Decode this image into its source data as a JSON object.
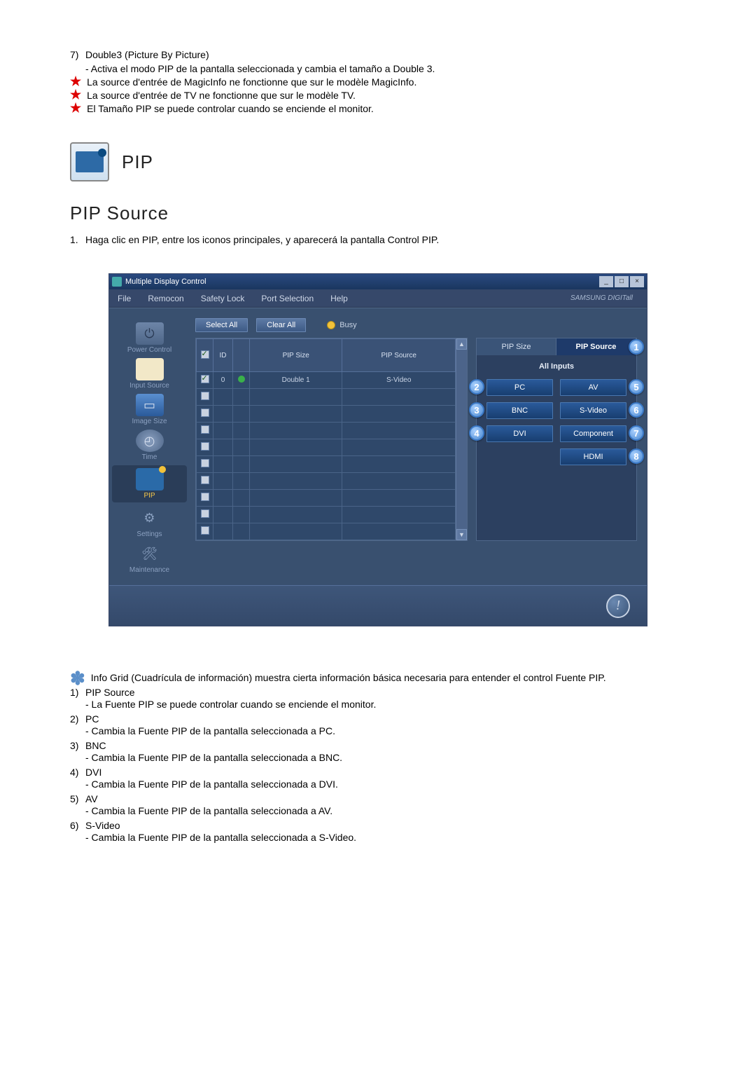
{
  "intro": {
    "item7_num": "7)",
    "item7_title": "Double3 (Picture By Picture)",
    "item7_desc": "- Activa el modo PIP de la pantalla seleccionada y cambia el tamaño a Double 3.",
    "star1": "La source d'entrée de MagicInfo ne fonctionne que sur le modèle MagicInfo.",
    "star2": "La source d'entrée de TV ne fonctionne que sur le modèle TV.",
    "star3": "El Tamaño PIP se puede controlar cuando se enciende el monitor."
  },
  "pip_label": "PIP",
  "section_title": "PIP Source",
  "section_line1_num": "1.",
  "section_line1_text": "Haga clic en PIP, entre los iconos principales, y aparecerá la pantalla Control PIP.",
  "window": {
    "title": "Multiple Display Control",
    "menu": {
      "file": "File",
      "remocon": "Remocon",
      "safety": "Safety Lock",
      "port": "Port Selection",
      "help": "Help"
    },
    "brand": "SAMSUNG DIGITall",
    "sidebar": {
      "power": "Power Control",
      "input": "Input Source",
      "image": "Image Size",
      "time": "Time",
      "pip": "PIP",
      "settings": "Settings",
      "maintenance": "Maintenance"
    },
    "buttons": {
      "select_all": "Select All",
      "clear_all": "Clear All",
      "busy": "Busy"
    },
    "headers": {
      "id": "ID",
      "pipsize": "PIP Size",
      "pipsource": "PIP Source"
    },
    "row0": {
      "id": "0",
      "size": "Double 1",
      "source": "S-Video"
    },
    "right": {
      "tab1": "PIP Size",
      "tab2": "PIP Source",
      "all_inputs": "All Inputs",
      "pc": "PC",
      "av": "AV",
      "bnc": "BNC",
      "svideo": "S-Video",
      "dvi": "DVI",
      "component": "Component",
      "hdmi": "HDMI"
    },
    "callouts": {
      "c1": "1",
      "c2": "2",
      "c3": "3",
      "c4": "4",
      "c5": "5",
      "c6": "6",
      "c7": "7",
      "c8": "8"
    }
  },
  "post_star": "Info Grid (Cuadrícula de información) muestra cierta información básica necesaria para entender el control Fuente PIP.",
  "list": {
    "n1": "1)",
    "t1": "PIP Source",
    "d1": "- La Fuente PIP se puede controlar cuando se enciende el monitor.",
    "n2": "2)",
    "t2": "PC",
    "d2": "- Cambia la Fuente PIP de la pantalla seleccionada a PC.",
    "n3": "3)",
    "t3": "BNC",
    "d3": "- Cambia la Fuente PIP de la pantalla seleccionada a BNC.",
    "n4": "4)",
    "t4": "DVI",
    "d4": "- Cambia la Fuente PIP de la pantalla seleccionada a DVI.",
    "n5": "5)",
    "t5": "AV",
    "d5": "- Cambia la Fuente PIP de la pantalla seleccionada a AV.",
    "n6": "6)",
    "t6": "S-Video",
    "d6": "- Cambia la Fuente PIP de la pantalla seleccionada a S-Video."
  }
}
